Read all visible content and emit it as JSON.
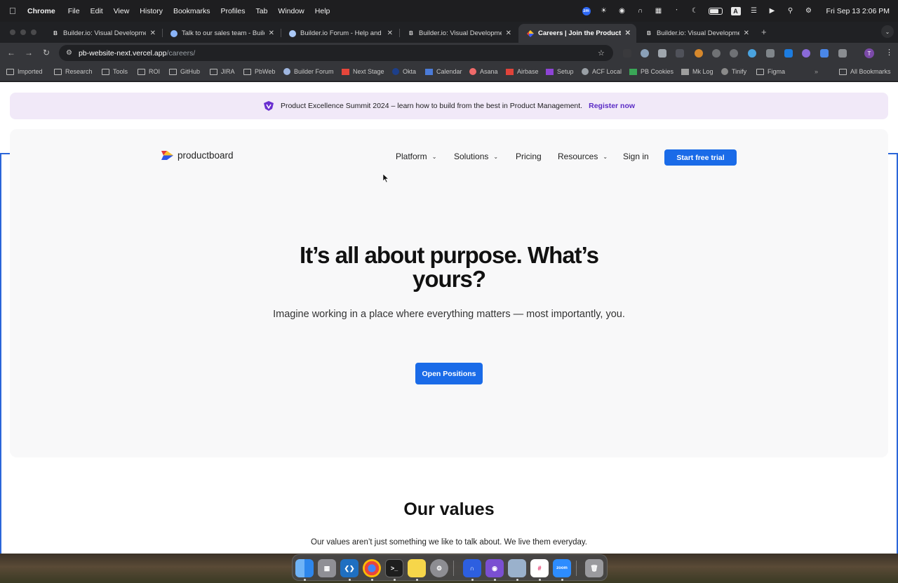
{
  "menubar": {
    "apple_icon": "apple-icon",
    "items": [
      "Chrome",
      "File",
      "Edit",
      "View",
      "History",
      "Bookmarks",
      "Profiles",
      "Tab",
      "Window",
      "Help"
    ],
    "zoom_badge": "zm",
    "input_source": "A",
    "clock": "Fri Sep 13  2:06 PM"
  },
  "tabs": [
    {
      "title": "Builder.io: Visual Developmen",
      "favicon": "builder-icon"
    },
    {
      "title": "Talk to our sales team - Build",
      "favicon": "globe-icon"
    },
    {
      "title": "Builder.io Forum - Help and t",
      "favicon": "forum-icon"
    },
    {
      "title": "Builder.io: Visual Developmen",
      "favicon": "builder-icon"
    },
    {
      "title": "Careers | Join the Productboa",
      "favicon": "productboard-icon",
      "active": true
    },
    {
      "title": "Builder.io: Visual Developmen",
      "favicon": "builder-icon"
    }
  ],
  "address": {
    "host": "pb-website-next.vercel.app",
    "path": "/careers/"
  },
  "bookmarks": [
    "Imported",
    "Research",
    "Tools",
    "ROI",
    "GitHub",
    "JIRA",
    "PbWeb",
    "Builder Forum",
    "Next Stage",
    "Okta",
    "Calendar",
    "Asana",
    "Airbase",
    "Setup",
    "ACF Local",
    "PB Cookies",
    "Mk Log",
    "Tinify",
    "Figma",
    "All Bookmarks"
  ],
  "profile_initial": "T",
  "banner": {
    "text": "Product Excellence Summit 2024 – learn how to build from the best in Product Management.",
    "link": "Register now"
  },
  "nav": {
    "logo": "productboard",
    "items": [
      "Platform",
      "Solutions",
      "Pricing",
      "Resources"
    ],
    "sign_in": "Sign in",
    "cta": "Start free trial"
  },
  "hero": {
    "headline_line1": "It’s all about purpose. What’s",
    "headline_line2": "yours?",
    "subhead": "Imagine working in a place where everything matters — most importantly, you.",
    "button": "Open Positions"
  },
  "values": {
    "title": "Our values",
    "subtitle": "Our values aren’t just something we like to talk about. We live them everyday."
  },
  "colors": {
    "brand_blue": "#1a6be8",
    "banner_bg": "#f1e9f8",
    "banner_link": "#5a2bc5",
    "hero_bg": "#f8f8f9"
  }
}
